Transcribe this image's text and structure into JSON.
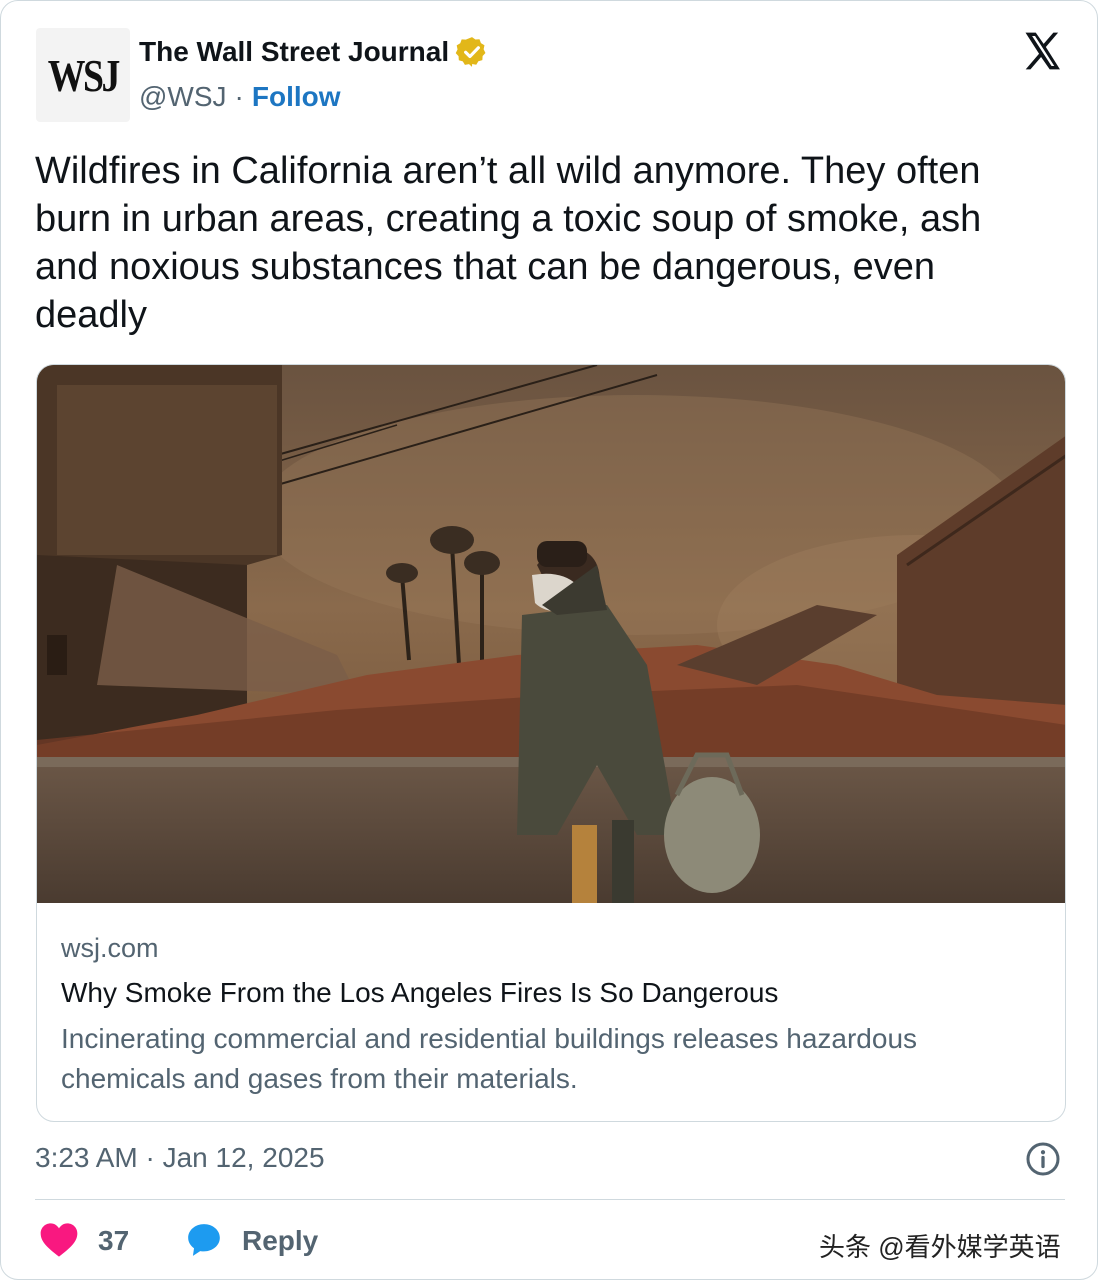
{
  "author": {
    "avatar_text": "WSJ",
    "name": "The Wall Street Journal",
    "handle": "@WSJ",
    "separator": "·",
    "follow_label": "Follow"
  },
  "tweet": {
    "text": "Wildfires in California aren’t all wild anymore. They often burn in urban areas, creating a toxic soup of smoke, ash and noxious substances that can be dangerous, even deadly"
  },
  "link_card": {
    "domain": "wsj.com",
    "headline": "Why Smoke From the Los Angeles Fires Is So Dangerous",
    "description": "Incinerating commercial and residential buildings releases hazardous chemicals and gases from their materials."
  },
  "timestamp": "3:23 AM · Jan 12, 2025",
  "actions": {
    "like_count": "37",
    "reply_label": "Reply"
  },
  "watermark": "头条 @看外媒学英语",
  "colors": {
    "follow": "#1d76c2",
    "like": "#f91880",
    "reply": "#1d9bf0",
    "verified": "#e2b719",
    "muted": "#536471"
  },
  "icons": [
    "verified-badge-icon",
    "x-logo-icon",
    "info-icon",
    "heart-icon",
    "reply-bubble-icon"
  ]
}
